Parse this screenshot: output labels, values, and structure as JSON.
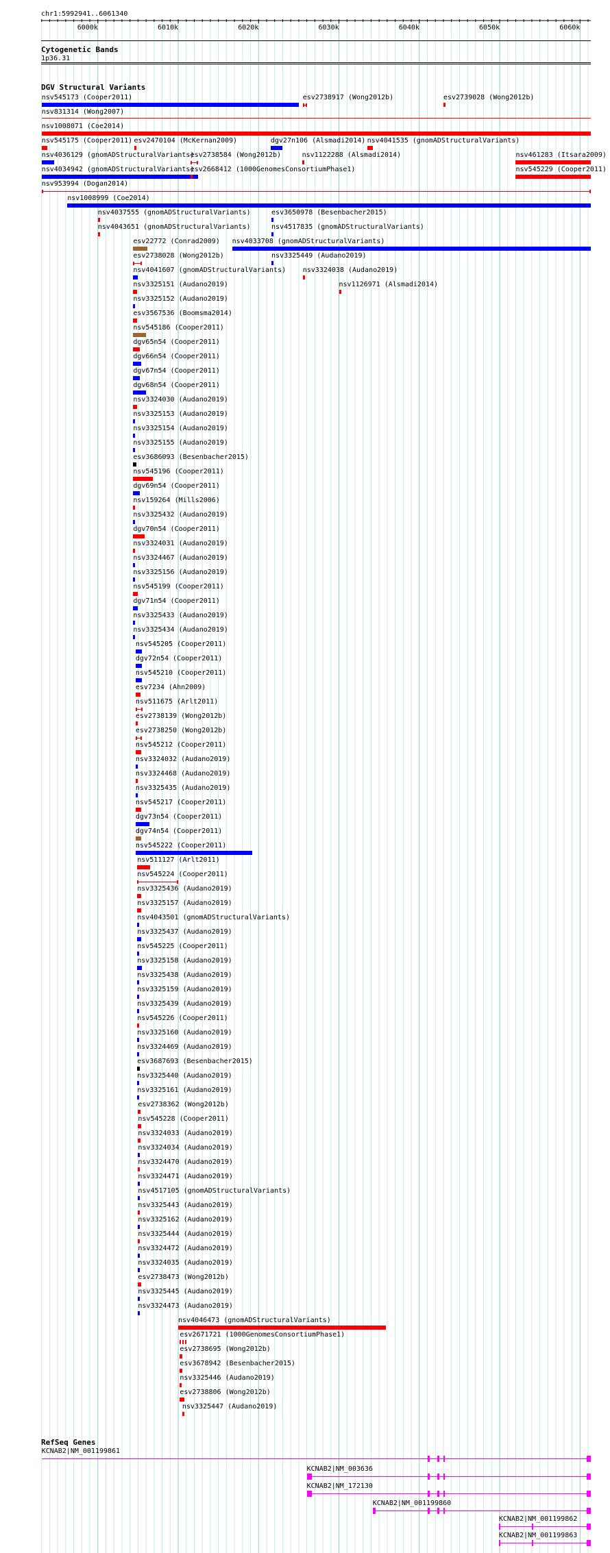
{
  "ruler": {
    "label": "chr1:5992941..6061340",
    "tick_labels": [
      {
        "pos": 6000000,
        "text": "6000k"
      },
      {
        "pos": 6010000,
        "text": "6010k"
      },
      {
        "pos": 6020000,
        "text": "6020k"
      },
      {
        "pos": 6030000,
        "text": "6030k"
      },
      {
        "pos": 6040000,
        "text": "6040k"
      },
      {
        "pos": 6050000,
        "text": "6050k"
      },
      {
        "pos": 6060000,
        "text": "6060k"
      }
    ],
    "start": 5992941,
    "end": 6061340
  },
  "cytoband": {
    "title": "Cytogenetic Bands",
    "band": "1p36.31"
  },
  "dgv": {
    "title": "DGV Structural Variants",
    "colors": {
      "loss": "#ff0000",
      "gain": "#0000ff",
      "both": "#996633",
      "other": "#000000"
    },
    "features": [
      {
        "label": "nsv545173 (Cooper2011)",
        "start": 5993000,
        "end": 6025000,
        "type": "gain"
      },
      {
        "label": "esv2738917 (Wong2012b)",
        "start": 6025500,
        "end": 6026000,
        "type": "loss",
        "style": "span"
      },
      {
        "label": "esv2739028 (Wong2012b)",
        "start": 6043000,
        "end": 6043200,
        "type": "loss"
      },
      {
        "label": "nsv831314 (Wong2007)",
        "start": 5993000,
        "end": 6061340,
        "type": "loss",
        "style": "line"
      },
      {
        "label": "nsv1008071 (Coe2014)",
        "start": 5993000,
        "end": 6061340,
        "type": "loss"
      },
      {
        "label": "nsv545175 (Cooper2011)",
        "start": 5993000,
        "end": 5993700,
        "type": "loss"
      },
      {
        "label": "esv2470104 (McKernan2009)",
        "start": 6004500,
        "end": 6004800,
        "type": "loss"
      },
      {
        "label": "dgv27n106 (Alsmadi2014)",
        "start": 6021500,
        "end": 6023000,
        "type": "gain"
      },
      {
        "label": "nsv4041535 (gnomADStructuralVariants)",
        "start": 6033500,
        "end": 6034200,
        "type": "loss"
      },
      {
        "label": "nsv4036129 (gnomADStructuralVariants)",
        "start": 5993000,
        "end": 5994600,
        "type": "gain"
      },
      {
        "label": "esv2738584 (Wong2012b)",
        "start": 6011500,
        "end": 6012500,
        "type": "loss",
        "style": "span"
      },
      {
        "label": "nsv1122288 (Alsmadi2014)",
        "start": 6025400,
        "end": 6025700,
        "type": "loss"
      },
      {
        "label": "nsv461283 (Itsara2009)",
        "start": 6052000,
        "end": 6061340,
        "type": "loss"
      },
      {
        "label": "nsv4034942 (gnomADStructuralVariants)",
        "start": 5993000,
        "end": 6012500,
        "type": "gain"
      },
      {
        "label": "esv2668412 (1000GenomesConsortiumPhase1)",
        "start": 6011500,
        "end": 6011800,
        "type": "loss"
      },
      {
        "label": "nsv545229 (Cooper2011)",
        "start": 6052000,
        "end": 6061340,
        "type": "loss"
      },
      {
        "label": "nsv953994 (Dogan2014)",
        "start": 5993000,
        "end": 6061340,
        "type": "loss",
        "style": "span"
      },
      {
        "label": "nsv1008999 (Coe2014)",
        "start": 5996200,
        "end": 6061340,
        "type": "gain"
      },
      {
        "label": "nsv4037555 (gnomADStructuralVariants)",
        "start": 6000000,
        "end": 6000200,
        "type": "loss"
      },
      {
        "label": "esv3650978 (Besenbacher2015)",
        "start": 6021600,
        "end": 6021800,
        "type": "gain"
      },
      {
        "label": "nsv4043651 (gnomADStructuralVariants)",
        "start": 6000000,
        "end": 6000200,
        "type": "loss"
      },
      {
        "label": "nsv4517835 (gnomADStructuralVariants)",
        "start": 6021600,
        "end": 6021800,
        "type": "gain"
      },
      {
        "label": "esv22772 (Conrad2009)",
        "start": 6004400,
        "end": 6006200,
        "type": "both"
      },
      {
        "label": "nsv4033708 (gnomADStructuralVariants)",
        "start": 6016700,
        "end": 6061340,
        "type": "gain"
      },
      {
        "label": "esv2738028 (Wong2012b)",
        "start": 6004400,
        "end": 6005500,
        "type": "loss",
        "style": "span"
      },
      {
        "label": "nsv3325449 (Audano2019)",
        "start": 6021600,
        "end": 6021800,
        "type": "gain"
      },
      {
        "label": "nsv4041607 (gnomADStructuralVariants)",
        "start": 6004400,
        "end": 6005000,
        "type": "gain"
      },
      {
        "label": "nsv3324038 (Audano2019)",
        "start": 6025500,
        "end": 6025700,
        "type": "loss"
      },
      {
        "label": "nsv3325151 (Audano2019)",
        "start": 6004400,
        "end": 6004900,
        "type": "loss"
      },
      {
        "label": "nsv1126971 (Alsmadi2014)",
        "start": 6030000,
        "end": 6030200,
        "type": "loss"
      },
      {
        "label": "nsv3325152 (Audano2019)",
        "start": 6004400,
        "end": 6004600,
        "type": "gain"
      },
      {
        "label": "esv3567536 (Boomsma2014)",
        "start": 6004400,
        "end": 6004900,
        "type": "loss"
      },
      {
        "label": "nsv545186 (Cooper2011)",
        "start": 6004400,
        "end": 6006000,
        "type": "both"
      },
      {
        "label": "dgv65n54 (Cooper2011)",
        "start": 6004400,
        "end": 6005200,
        "type": "loss"
      },
      {
        "label": "dgv66n54 (Cooper2011)",
        "start": 6004400,
        "end": 6005400,
        "type": "gain"
      },
      {
        "label": "dgv67n54 (Cooper2011)",
        "start": 6004400,
        "end": 6005200,
        "type": "gain"
      },
      {
        "label": "dgv68n54 (Cooper2011)",
        "start": 6004400,
        "end": 6006000,
        "type": "gain"
      },
      {
        "label": "nsv3324030 (Audano2019)",
        "start": 6004400,
        "end": 6004900,
        "type": "loss"
      },
      {
        "label": "nsv3325153 (Audano2019)",
        "start": 6004400,
        "end": 6004600,
        "type": "gain"
      },
      {
        "label": "nsv3325154 (Audano2019)",
        "start": 6004400,
        "end": 6004600,
        "type": "gain"
      },
      {
        "label": "nsv3325155 (Audano2019)",
        "start": 6004400,
        "end": 6004600,
        "type": "gain"
      },
      {
        "label": "esv3686093 (Besenbacher2015)",
        "start": 6004400,
        "end": 6004800,
        "type": "other"
      },
      {
        "label": "nsv545196 (Cooper2011)",
        "start": 6004400,
        "end": 6006800,
        "type": "loss"
      },
      {
        "label": "dgv69n54 (Cooper2011)",
        "start": 6004400,
        "end": 6005200,
        "type": "gain"
      },
      {
        "label": "nsv159264 (Mills2006)",
        "start": 6004400,
        "end": 6004600,
        "type": "loss"
      },
      {
        "label": "nsv3325432 (Audano2019)",
        "start": 6004400,
        "end": 6004600,
        "type": "gain"
      },
      {
        "label": "dgv70n54 (Cooper2011)",
        "start": 6004400,
        "end": 6005800,
        "type": "loss"
      },
      {
        "label": "nsv3324031 (Audano2019)",
        "start": 6004400,
        "end": 6004600,
        "type": "loss"
      },
      {
        "label": "nsv3324467 (Audano2019)",
        "start": 6004400,
        "end": 6004600,
        "type": "gain"
      },
      {
        "label": "nsv3325156 (Audano2019)",
        "start": 6004400,
        "end": 6004600,
        "type": "gain"
      },
      {
        "label": "nsv545199 (Cooper2011)",
        "start": 6004400,
        "end": 6005000,
        "type": "loss"
      },
      {
        "label": "dgv71n54 (Cooper2011)",
        "start": 6004400,
        "end": 6005000,
        "type": "gain"
      },
      {
        "label": "nsv3325433 (Audano2019)",
        "start": 6004400,
        "end": 6004600,
        "type": "gain"
      },
      {
        "label": "nsv3325434 (Audano2019)",
        "start": 6004400,
        "end": 6004600,
        "type": "gain"
      },
      {
        "label": "nsv545205 (Cooper2011)",
        "start": 6004700,
        "end": 6005500,
        "type": "gain"
      },
      {
        "label": "dgv72n54 (Cooper2011)",
        "start": 6004700,
        "end": 6005500,
        "type": "gain"
      },
      {
        "label": "nsv545210 (Cooper2011)",
        "start": 6004700,
        "end": 6005500,
        "type": "gain"
      },
      {
        "label": "esv7234 (Ahn2009)",
        "start": 6004700,
        "end": 6005300,
        "type": "loss"
      },
      {
        "label": "nsv511675 (Arlt2011)",
        "start": 6004700,
        "end": 6005600,
        "type": "loss",
        "style": "span"
      },
      {
        "label": "esv2738139 (Wong2012b)",
        "start": 6004700,
        "end": 6005000,
        "type": "loss"
      },
      {
        "label": "esv2738250 (Wong2012b)",
        "start": 6004700,
        "end": 6005500,
        "type": "loss",
        "style": "span"
      },
      {
        "label": "nsv545212 (Cooper2011)",
        "start": 6004700,
        "end": 6005400,
        "type": "loss"
      },
      {
        "label": "nsv3324032 (Audano2019)",
        "start": 6004700,
        "end": 6004900,
        "type": "gain"
      },
      {
        "label": "nsv3324468 (Audano2019)",
        "start": 6004700,
        "end": 6004900,
        "type": "loss"
      },
      {
        "label": "nsv3325435 (Audano2019)",
        "start": 6004700,
        "end": 6004900,
        "type": "gain"
      },
      {
        "label": "nsv545217 (Cooper2011)",
        "start": 6004700,
        "end": 6005400,
        "type": "loss"
      },
      {
        "label": "dgv73n54 (Cooper2011)",
        "start": 6004700,
        "end": 6006400,
        "type": "gain"
      },
      {
        "label": "dgv74n54 (Cooper2011)",
        "start": 6004700,
        "end": 6005400,
        "type": "both"
      },
      {
        "label": "nsv545222 (Cooper2011)",
        "start": 6004700,
        "end": 6019200,
        "type": "gain"
      },
      {
        "label": "nsv511127 (Arlt2011)",
        "start": 6004900,
        "end": 6006500,
        "type": "loss"
      },
      {
        "label": "nsv545224 (Cooper2011)",
        "start": 6004900,
        "end": 6010000,
        "type": "loss",
        "style": "span"
      },
      {
        "label": "nsv3325436 (Audano2019)",
        "start": 6004900,
        "end": 6005400,
        "type": "loss"
      },
      {
        "label": "nsv3325157 (Audano2019)",
        "start": 6004900,
        "end": 6005400,
        "type": "loss"
      },
      {
        "label": "nsv4043501 (gnomADStructuralVariants)",
        "start": 6004900,
        "end": 6005100,
        "type": "gain"
      },
      {
        "label": "nsv3325437 (Audano2019)",
        "start": 6004900,
        "end": 6005400,
        "type": "gain"
      },
      {
        "label": "nsv545225 (Cooper2011)",
        "start": 6004900,
        "end": 6005100,
        "type": "gain"
      },
      {
        "label": "nsv3325158 (Audano2019)",
        "start": 6004900,
        "end": 6005500,
        "type": "gain"
      },
      {
        "label": "nsv3325438 (Audano2019)",
        "start": 6004900,
        "end": 6005100,
        "type": "gain"
      },
      {
        "label": "nsv3325159 (Audano2019)",
        "start": 6004900,
        "end": 6005100,
        "type": "gain"
      },
      {
        "label": "nsv3325439 (Audano2019)",
        "start": 6004900,
        "end": 6005100,
        "type": "gain"
      },
      {
        "label": "nsv545226 (Cooper2011)",
        "start": 6004900,
        "end": 6005100,
        "type": "loss"
      },
      {
        "label": "nsv3325160 (Audano2019)",
        "start": 6004900,
        "end": 6005100,
        "type": "gain"
      },
      {
        "label": "nsv3324469 (Audano2019)",
        "start": 6004900,
        "end": 6005100,
        "type": "gain"
      },
      {
        "label": "esv3687693 (Besenbacher2015)",
        "start": 6004900,
        "end": 6005200,
        "type": "other"
      },
      {
        "label": "nsv3325440 (Audano2019)",
        "start": 6004900,
        "end": 6005100,
        "type": "gain"
      },
      {
        "label": "nsv3325161 (Audano2019)",
        "start": 6004900,
        "end": 6005100,
        "type": "gain"
      },
      {
        "label": "esv2738362 (Wong2012b)",
        "start": 6005000,
        "end": 6005300,
        "type": "loss"
      },
      {
        "label": "nsv545228 (Cooper2011)",
        "start": 6005000,
        "end": 6005400,
        "type": "loss"
      },
      {
        "label": "nsv3324033 (Audano2019)",
        "start": 6005000,
        "end": 6005300,
        "type": "loss"
      },
      {
        "label": "nsv3324034 (Audano2019)",
        "start": 6005000,
        "end": 6005200,
        "type": "gain"
      },
      {
        "label": "nsv3324470 (Audano2019)",
        "start": 6005000,
        "end": 6005200,
        "type": "loss"
      },
      {
        "label": "nsv3324471 (Audano2019)",
        "start": 6005000,
        "end": 6005200,
        "type": "gain"
      },
      {
        "label": "nsv4517105 (gnomADStructuralVariants)",
        "start": 6005000,
        "end": 6005200,
        "type": "gain"
      },
      {
        "label": "nsv3325443 (Audano2019)",
        "start": 6005000,
        "end": 6005200,
        "type": "loss"
      },
      {
        "label": "nsv3325162 (Audano2019)",
        "start": 6005000,
        "end": 6005200,
        "type": "gain"
      },
      {
        "label": "nsv3325444 (Audano2019)",
        "start": 6005000,
        "end": 6005200,
        "type": "loss"
      },
      {
        "label": "nsv3324472 (Audano2019)",
        "start": 6005000,
        "end": 6005200,
        "type": "gain"
      },
      {
        "label": "nsv3324035 (Audano2019)",
        "start": 6005000,
        "end": 6005200,
        "type": "gain"
      },
      {
        "label": "esv2738473 (Wong2012b)",
        "start": 6005000,
        "end": 6005400,
        "type": "loss"
      },
      {
        "label": "nsv3325445 (Audano2019)",
        "start": 6005000,
        "end": 6005200,
        "type": "gain"
      },
      {
        "label": "nsv3324473 (Audano2019)",
        "start": 6005000,
        "end": 6005200,
        "type": "gain"
      },
      {
        "label": "nsv4046473 (gnomADStructuralVariants)",
        "start": 6010000,
        "end": 6035800,
        "type": "loss"
      },
      {
        "label": "esv2671721 (1000GenomesConsortiumPhase1)",
        "start": 6010200,
        "end": 6011000,
        "type": "loss",
        "style": "dots"
      },
      {
        "label": "esv2738695 (Wong2012b)",
        "start": 6010200,
        "end": 6010500,
        "type": "loss"
      },
      {
        "label": "esv3678942 (Besenbacher2015)",
        "start": 6010200,
        "end": 6010500,
        "type": "loss"
      },
      {
        "label": "nsv3325446 (Audano2019)",
        "start": 6010200,
        "end": 6010400,
        "type": "loss"
      },
      {
        "label": "esv2738806 (Wong2012b)",
        "start": 6010200,
        "end": 6010800,
        "type": "loss"
      },
      {
        "label": "nsv3325447 (Audano2019)",
        "start": 6010500,
        "end": 6010700,
        "type": "loss"
      }
    ]
  },
  "refseq": {
    "title": "RefSeq Genes",
    "color": "#ff00ff",
    "genes": [
      {
        "label": "KCNAB2|NM_001199861",
        "start": 5993000,
        "end": 6061340,
        "exons": [
          [
            6041000,
            6041300
          ],
          [
            6042200,
            6042500
          ],
          [
            6043000,
            6043100
          ],
          [
            6060800,
            6061340
          ]
        ]
      },
      {
        "label": "KCNAB2|NM_003636",
        "start": 6026000,
        "end": 6061340,
        "exons": [
          [
            6026000,
            6026600
          ],
          [
            6041000,
            6041300
          ],
          [
            6042200,
            6042500
          ],
          [
            6043000,
            6043100
          ],
          [
            6060800,
            6061340
          ]
        ]
      },
      {
        "label": "KCNAB2|NM_172130",
        "start": 6026000,
        "end": 6061340,
        "exons": [
          [
            6026000,
            6026600
          ],
          [
            6041000,
            6041300
          ],
          [
            6042200,
            6042500
          ],
          [
            6043000,
            6043100
          ],
          [
            6060800,
            6061340
          ]
        ]
      },
      {
        "label": "KCNAB2|NM_001199860",
        "start": 6034200,
        "end": 6061340,
        "exons": [
          [
            6034200,
            6034600
          ],
          [
            6041000,
            6041300
          ],
          [
            6042200,
            6042500
          ],
          [
            6043000,
            6043100
          ],
          [
            6060800,
            6061340
          ]
        ]
      },
      {
        "label": "KCNAB2|NM_001199862",
        "start": 6049900,
        "end": 6061340,
        "exons": [
          [
            6049900,
            6050100
          ],
          [
            6054000,
            6054200
          ],
          [
            6060800,
            6061340
          ]
        ]
      },
      {
        "label": "KCNAB2|NM_001199863",
        "start": 6049900,
        "end": 6061340,
        "exons": [
          [
            6049900,
            6050100
          ],
          [
            6054000,
            6054200
          ],
          [
            6060800,
            6061340
          ]
        ]
      }
    ]
  }
}
